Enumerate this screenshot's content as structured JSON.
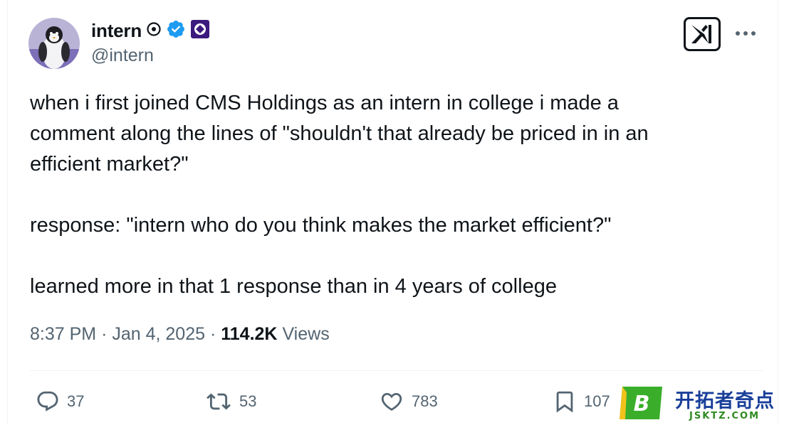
{
  "tweet": {
    "author": {
      "display_name": "intern",
      "handle": "@intern"
    },
    "text": {
      "line1": "when i first joined CMS Holdings as an intern in college i made a",
      "line2": "comment along the lines of \"shouldn't that already be priced in in an",
      "line3": "efficient market?\"",
      "line4": "response: \"intern who do you think makes the market efficient?\"",
      "line5": "learned more in that 1 response than in 4 years of college"
    },
    "meta": {
      "time": "8:37 PM",
      "separator": "·",
      "date": "Jan 4, 2025",
      "views_count": "114.2K",
      "views_label": "Views"
    },
    "actions": {
      "replies": "37",
      "reposts": "53",
      "likes": "783",
      "bookmarks": "107"
    }
  },
  "watermark": {
    "letter": "B",
    "cn_text": "开拓者奇点",
    "en_text": "JSKTZ.COM"
  },
  "colors": {
    "text_primary": "#0f1419",
    "text_secondary": "#536471",
    "verified_blue": "#1d9bf0",
    "badge_purple": "#3c1a7d",
    "divider": "#eff3f4"
  },
  "icons": [
    "avatar-penguin",
    "pin-circle-icon",
    "verified-badge-icon",
    "affiliate-badge-icon",
    "xai-logo-icon",
    "more-icon",
    "reply-icon",
    "repost-icon",
    "like-icon",
    "bookmark-icon"
  ]
}
